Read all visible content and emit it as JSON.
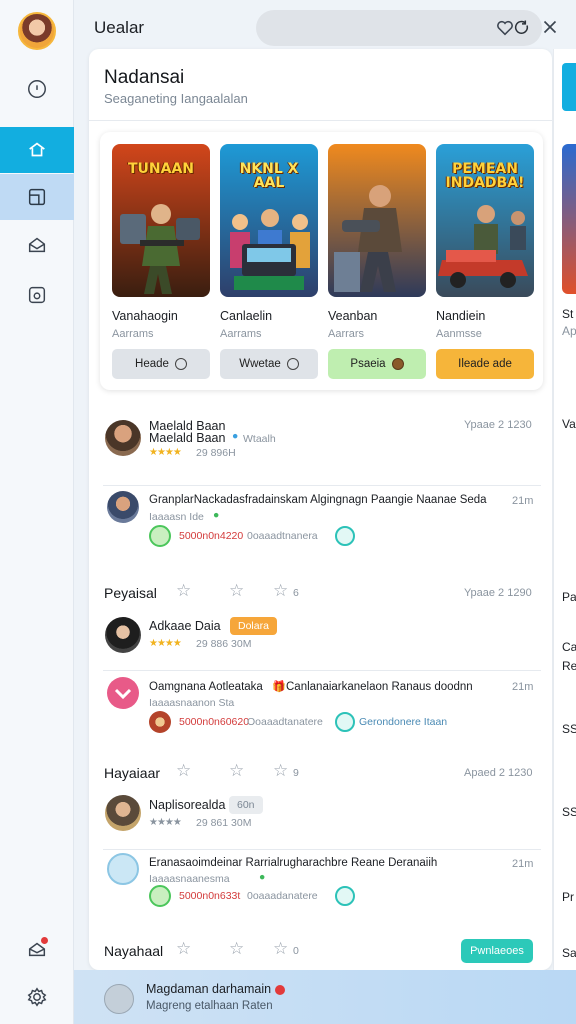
{
  "app": {
    "title": "Uealar",
    "accent": "#12aee0"
  },
  "rail": {
    "items": [
      "clock-icon",
      "home-icon",
      "board-icon",
      "mail-open-icon",
      "box-icon"
    ],
    "bottom": [
      "inbox-icon",
      "settings-icon"
    ]
  },
  "panel": {
    "title": "Nadansai",
    "subtitle": "Seaganeting Iangaalalan"
  },
  "games": [
    {
      "art_title": "TUNAAN",
      "name": "Vanahaogin",
      "sub": "Aarrams",
      "btn": "Heade",
      "btn_color": "#dfe3e8"
    },
    {
      "art_title": "NKNL X AAL",
      "name": "Canlaelin",
      "sub": "Aarrams",
      "btn": "Wwetae",
      "btn_color": "#dfe3e8"
    },
    {
      "art_title": "",
      "name": "Veanban",
      "sub": "Aarrars",
      "btn": "Psaeia",
      "btn_color": "#bfeeb0"
    },
    {
      "art_title": "PEMEAN INDADBA!",
      "name": "Nandiein",
      "sub": "Aanmsse",
      "btn": "Ileade ade",
      "btn_color": "#f6b53a"
    }
  ],
  "feed": {
    "row1": {
      "name": "Maelald Baan",
      "meta1": "Maelald Baan",
      "meta2": "Wtaalh",
      "stars": "★★★★",
      "count": "29 896H",
      "time": "Ypaae 2 1230"
    },
    "row2": {
      "name": "GranplarNackadasfradainskam Algingnagn Paangie Naanae Seda",
      "sub": "Iaaaasn Ide",
      "code_red": "5000n0n4220",
      "code_grey": "0oaaadtnanera",
      "time": "21m"
    },
    "sec1": {
      "title": "Peyaisal",
      "count": "6",
      "time": "Ypaae 2 1290"
    },
    "row3": {
      "name": "Adkaae Daia",
      "badge": "Dolara",
      "stars": "★★★★",
      "count": "29 886 30M"
    },
    "row4": {
      "name": "Oamgnana Aotleataka",
      "name2": "Canlanaiarkanelaon Ranaus doodnn",
      "sub": "Iaaaasnaanon Sta",
      "code_red": "5000n0n60620",
      "code_grey": "Ooaaadtanatere",
      "link": "Gerondonere Itaan",
      "time": "21m"
    },
    "sec2": {
      "title": "Hayaiaar",
      "count": "9",
      "time": "Apaed 2 1230"
    },
    "row5": {
      "name": "Naplisorealda",
      "badge": "60n",
      "stars": "★★★★",
      "count": "29 861 30M"
    },
    "row6": {
      "name": "Eranasaoimdeinar Rarrialrugharachbre Reane Deranaiih",
      "sub": "Iaaaasnaanesma",
      "code_red": "5000n0n633t",
      "code_grey": "0oaaadanatere",
      "time": "21m"
    },
    "sec3": {
      "title": "Nayahaal",
      "count": "0",
      "button": "Pwnlaeoes"
    }
  },
  "peek": [
    "St",
    "Ap",
    "Va",
    "Pa",
    "Ca",
    "Re",
    "SS",
    "SS",
    "Pr",
    "Sa"
  ],
  "bottom": {
    "line1": "Magdaman darhamain",
    "line2": "Magreng etalhaan Raten"
  }
}
